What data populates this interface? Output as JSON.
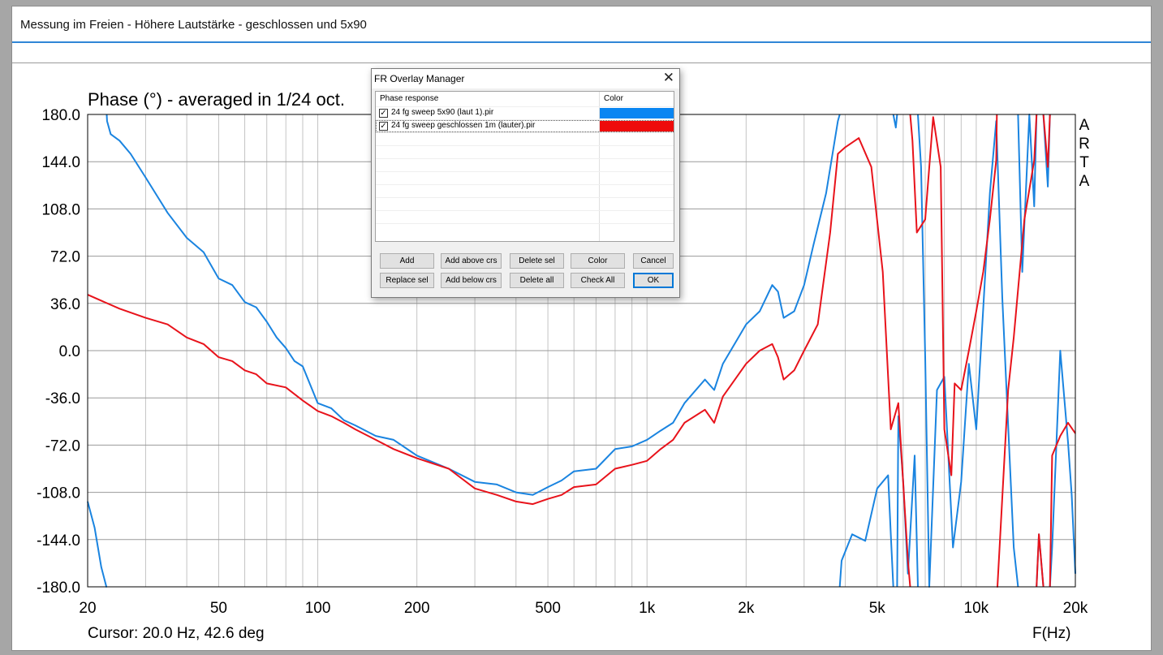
{
  "window": {
    "title": "Messung im Freien - Höhere Lautstärke - geschlossen und 5x90"
  },
  "chart_data": {
    "type": "line",
    "title": "Phase (°) - averaged in 1/24 oct.",
    "xlabel": "F(Hz)",
    "ylabel": "",
    "x_scale": "log",
    "xlim": [
      20,
      20000
    ],
    "ylim": [
      -180,
      180
    ],
    "grid": true,
    "y_ticks": [
      "180.0",
      "144.0",
      "108.0",
      "72.0",
      "36.0",
      "0.0",
      "-36.0",
      "-72.0",
      "-108.0",
      "-144.0",
      "-180.0"
    ],
    "y_tick_values": [
      180,
      144,
      108,
      72,
      36,
      0,
      -36,
      -72,
      -108,
      -144,
      -180
    ],
    "x_ticks": [
      {
        "value": 20,
        "label": "20"
      },
      {
        "value": 50,
        "label": "50"
      },
      {
        "value": 100,
        "label": "100"
      },
      {
        "value": 200,
        "label": "200"
      },
      {
        "value": 500,
        "label": "500"
      },
      {
        "value": 1000,
        "label": "1k"
      },
      {
        "value": 2000,
        "label": "2k"
      },
      {
        "value": 5000,
        "label": "5k"
      },
      {
        "value": 10000,
        "label": "10k"
      },
      {
        "value": 20000,
        "label": "20k"
      }
    ],
    "cursor_text": "Cursor: 20.0 Hz, 42.6 deg",
    "watermark": [
      "A",
      "R",
      "T",
      "A"
    ],
    "series": [
      {
        "name": "24 fg sweep 5x90 (laut 1).pir",
        "color": "#1a84e0",
        "points": [
          [
            20,
            -115
          ],
          [
            21,
            -135
          ],
          [
            22,
            -165
          ],
          [
            22.8,
            -180
          ],
          [
            22.9,
            175
          ],
          [
            23.5,
            165
          ],
          [
            25,
            160
          ],
          [
            27,
            150
          ],
          [
            30,
            132
          ],
          [
            35,
            105
          ],
          [
            40,
            86
          ],
          [
            45,
            75
          ],
          [
            50,
            55
          ],
          [
            55,
            50
          ],
          [
            60,
            37
          ],
          [
            65,
            33
          ],
          [
            70,
            22
          ],
          [
            75,
            10
          ],
          [
            80,
            2
          ],
          [
            85,
            -8
          ],
          [
            90,
            -12
          ],
          [
            100,
            -40
          ],
          [
            110,
            -44
          ],
          [
            120,
            -53
          ],
          [
            130,
            -57
          ],
          [
            150,
            -65
          ],
          [
            170,
            -68
          ],
          [
            200,
            -80
          ],
          [
            250,
            -90
          ],
          [
            300,
            -100
          ],
          [
            350,
            -102
          ],
          [
            400,
            -108
          ],
          [
            450,
            -110
          ],
          [
            500,
            -104
          ],
          [
            550,
            -99
          ],
          [
            600,
            -92
          ],
          [
            700,
            -90
          ],
          [
            800,
            -75
          ],
          [
            900,
            -73
          ],
          [
            1000,
            -68
          ],
          [
            1100,
            -61
          ],
          [
            1200,
            -55
          ],
          [
            1300,
            -40
          ],
          [
            1500,
            -22
          ],
          [
            1600,
            -30
          ],
          [
            1700,
            -10
          ],
          [
            2000,
            20
          ],
          [
            2200,
            30
          ],
          [
            2400,
            50
          ],
          [
            2500,
            45
          ],
          [
            2600,
            25
          ],
          [
            2800,
            30
          ],
          [
            3000,
            50
          ],
          [
            3200,
            80
          ],
          [
            3500,
            120
          ],
          [
            3800,
            175
          ],
          [
            3900,
            -160
          ],
          [
            4200,
            -140
          ],
          [
            4600,
            -145
          ],
          [
            5000,
            -105
          ],
          [
            5400,
            -95
          ],
          [
            5500,
            -140
          ],
          [
            5700,
            170
          ],
          [
            5800,
            -50
          ],
          [
            6000,
            -100
          ],
          [
            6200,
            -170
          ],
          [
            6500,
            -80
          ],
          [
            6800,
            140
          ],
          [
            7000,
            -5
          ],
          [
            7200,
            -180
          ],
          [
            7600,
            -30
          ],
          [
            8000,
            -20
          ],
          [
            8500,
            -150
          ],
          [
            9000,
            -100
          ],
          [
            9500,
            -10
          ],
          [
            10000,
            -60
          ],
          [
            11000,
            120
          ],
          [
            11500,
            175
          ],
          [
            12000,
            40
          ],
          [
            13000,
            -150
          ],
          [
            13800,
            60
          ],
          [
            14500,
            180
          ],
          [
            15000,
            110
          ],
          [
            15500,
            -140
          ],
          [
            16500,
            125
          ],
          [
            17000,
            -150
          ],
          [
            18000,
            0
          ],
          [
            19000,
            -70
          ],
          [
            19500,
            -110
          ],
          [
            20000,
            -170
          ]
        ]
      },
      {
        "name": "24 fg sweep geschlossen 1m (lauter).pir",
        "color": "#e8131b",
        "points": [
          [
            20,
            42.6
          ],
          [
            25,
            32
          ],
          [
            30,
            25
          ],
          [
            35,
            20
          ],
          [
            40,
            10
          ],
          [
            45,
            5
          ],
          [
            50,
            -5
          ],
          [
            55,
            -8
          ],
          [
            60,
            -15
          ],
          [
            65,
            -18
          ],
          [
            70,
            -25
          ],
          [
            80,
            -28
          ],
          [
            90,
            -38
          ],
          [
            100,
            -46
          ],
          [
            110,
            -50
          ],
          [
            120,
            -55
          ],
          [
            130,
            -60
          ],
          [
            150,
            -68
          ],
          [
            170,
            -75
          ],
          [
            200,
            -82
          ],
          [
            250,
            -90
          ],
          [
            300,
            -105
          ],
          [
            350,
            -110
          ],
          [
            400,
            -115
          ],
          [
            450,
            -117
          ],
          [
            500,
            -113
          ],
          [
            550,
            -110
          ],
          [
            600,
            -104
          ],
          [
            700,
            -102
          ],
          [
            800,
            -90
          ],
          [
            900,
            -87
          ],
          [
            1000,
            -84
          ],
          [
            1100,
            -75
          ],
          [
            1200,
            -68
          ],
          [
            1300,
            -55
          ],
          [
            1500,
            -45
          ],
          [
            1600,
            -55
          ],
          [
            1700,
            -35
          ],
          [
            2000,
            -10
          ],
          [
            2200,
            0
          ],
          [
            2400,
            5
          ],
          [
            2500,
            -5
          ],
          [
            2600,
            -22
          ],
          [
            2800,
            -15
          ],
          [
            3000,
            0
          ],
          [
            3300,
            20
          ],
          [
            3600,
            90
          ],
          [
            3800,
            150
          ],
          [
            4000,
            155
          ],
          [
            4400,
            162
          ],
          [
            4800,
            140
          ],
          [
            5200,
            60
          ],
          [
            5500,
            -60
          ],
          [
            5800,
            -40
          ],
          [
            6200,
            -160
          ],
          [
            6400,
            160
          ],
          [
            6600,
            90
          ],
          [
            7000,
            100
          ],
          [
            7400,
            178
          ],
          [
            7800,
            140
          ],
          [
            8000,
            -60
          ],
          [
            8400,
            -95
          ],
          [
            8600,
            -25
          ],
          [
            9000,
            -30
          ],
          [
            9500,
            0
          ],
          [
            10000,
            30
          ],
          [
            10500,
            60
          ],
          [
            11000,
            100
          ],
          [
            11500,
            145
          ],
          [
            11600,
            -180
          ],
          [
            12500,
            -30
          ],
          [
            13000,
            10
          ],
          [
            14000,
            100
          ],
          [
            15000,
            145
          ],
          [
            15500,
            -140
          ],
          [
            16500,
            140
          ],
          [
            17000,
            -80
          ],
          [
            18000,
            -65
          ],
          [
            19000,
            -55
          ],
          [
            20000,
            -63
          ]
        ]
      }
    ]
  },
  "dialog": {
    "title": "FR Overlay Manager",
    "close_glyph": "✕",
    "col_name": "Phase response",
    "col_color": "Color",
    "rows": [
      {
        "label": "24 fg sweep 5x90 (laut 1).pir",
        "checked": true,
        "color": "#0a86f2"
      },
      {
        "label": "24 fg sweep geschlossen 1m (lauter).pir",
        "checked": true,
        "color": "#ee0b0b"
      }
    ],
    "check_glyph": "✓",
    "buttons": {
      "add": "Add",
      "add_above": "Add above crs",
      "delete_sel": "Delete sel",
      "color": "Color",
      "cancel": "Cancel",
      "replace_sel": "Replace sel",
      "add_below": "Add below crs",
      "delete_all": "Delete all",
      "check_all": "Check All",
      "ok": "OK"
    }
  }
}
